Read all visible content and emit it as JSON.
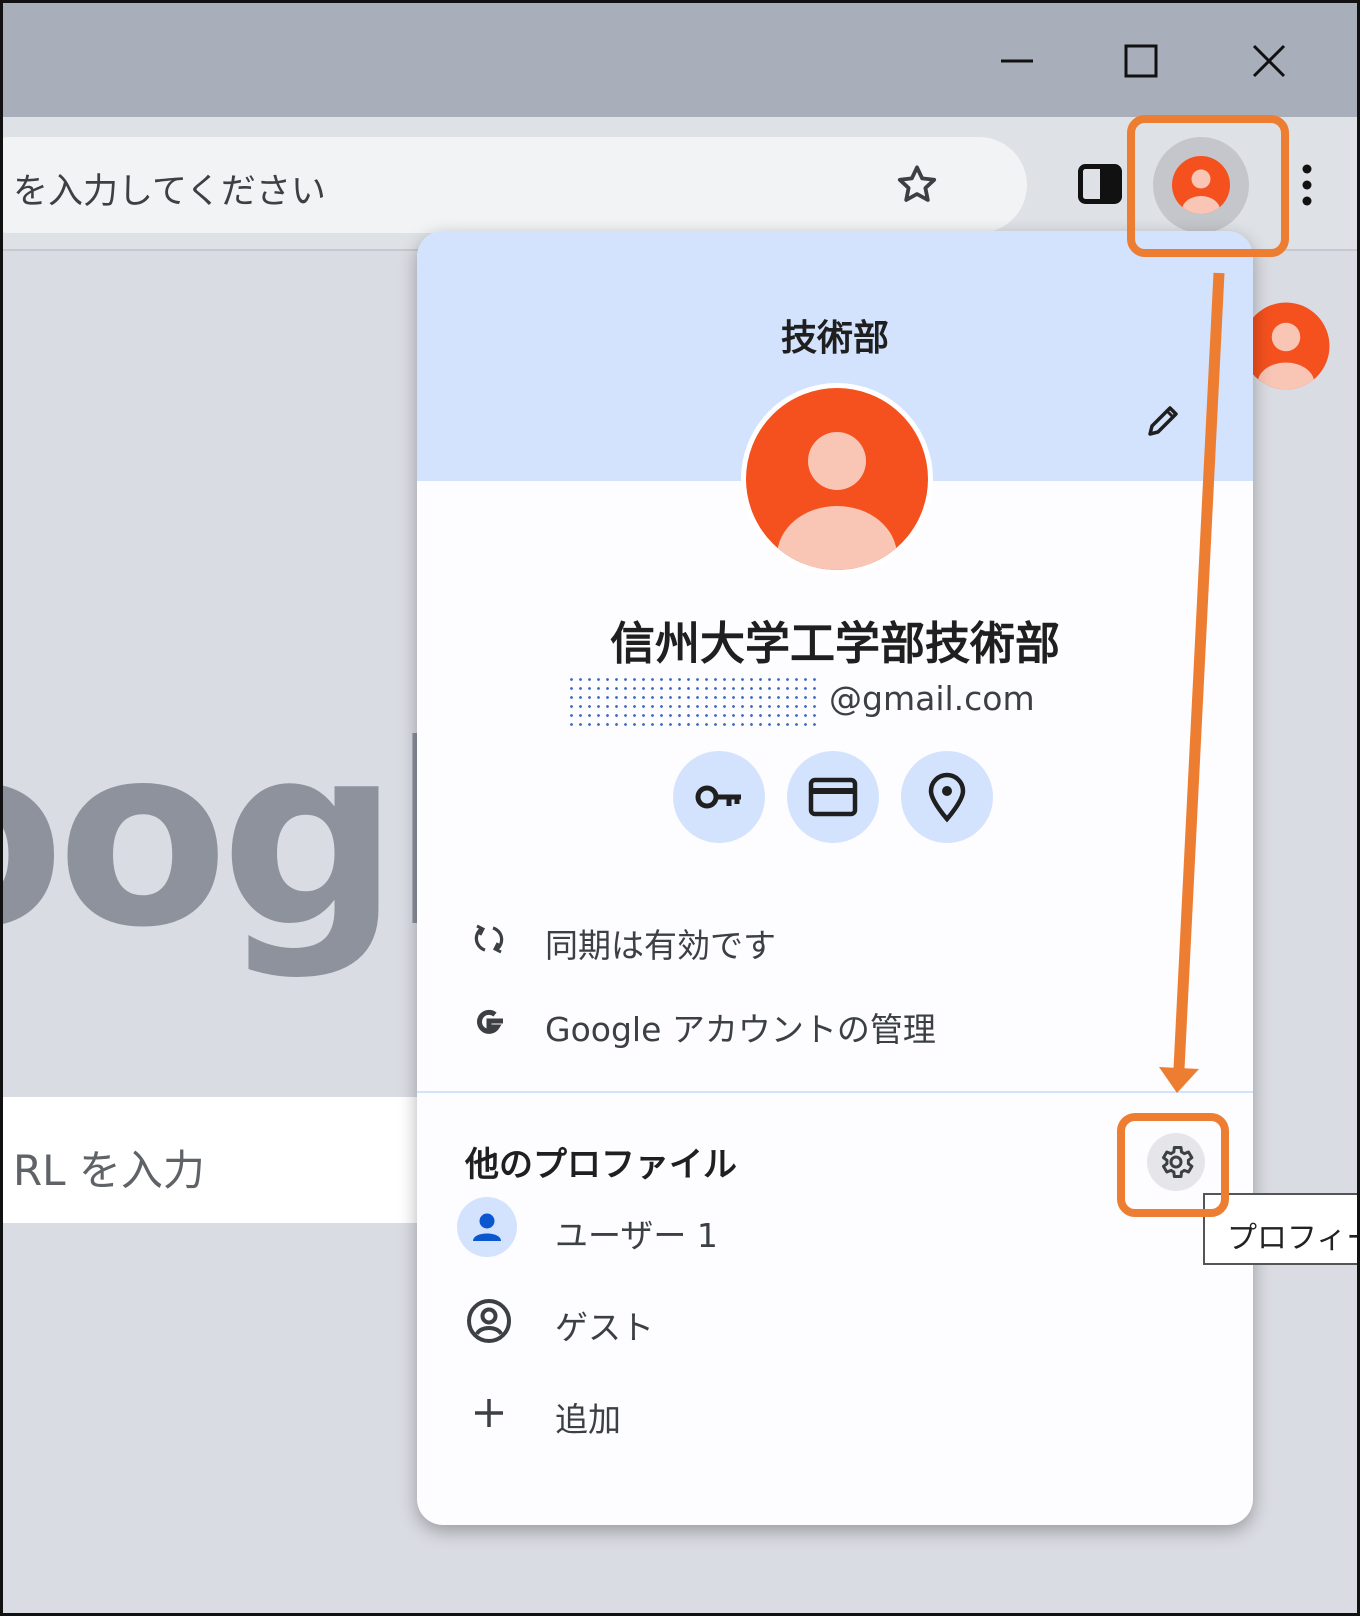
{
  "window": {
    "minimize_icon": "minimize-icon",
    "maximize_icon": "maximize-icon",
    "close_icon": "close-icon"
  },
  "toolbar": {
    "omnibox_placeholder": "を入力してください",
    "star_icon": "star-icon",
    "side_panel_icon": "side-panel-icon",
    "profile_icon": "avatar-icon",
    "menu_icon": "kebab-menu-icon"
  },
  "page": {
    "logo_text": "oogl",
    "search_placeholder": "RL を入力"
  },
  "popup": {
    "profile_name": "技術部",
    "full_name": "信州大学工学部技術部",
    "email_domain": "@gmail.com",
    "quick_actions": [
      {
        "name": "password-key-icon"
      },
      {
        "name": "payment-card-icon"
      },
      {
        "name": "address-pin-icon"
      }
    ],
    "sync_label": "同期は有効です",
    "account_label": "Google アカウントの管理",
    "other_profiles_title": "他のプロファイル",
    "profiles": [
      {
        "label": "ユーザー 1"
      },
      {
        "label": "ゲスト"
      },
      {
        "label": "追加"
      }
    ]
  },
  "tooltip": {
    "text": "プロフィール"
  },
  "colors": {
    "accent_orange": "#ed7d31",
    "avatar_orange": "#f4511e",
    "header_blue": "#d3e3fd",
    "user_icon_blue": "#0b57d0"
  }
}
